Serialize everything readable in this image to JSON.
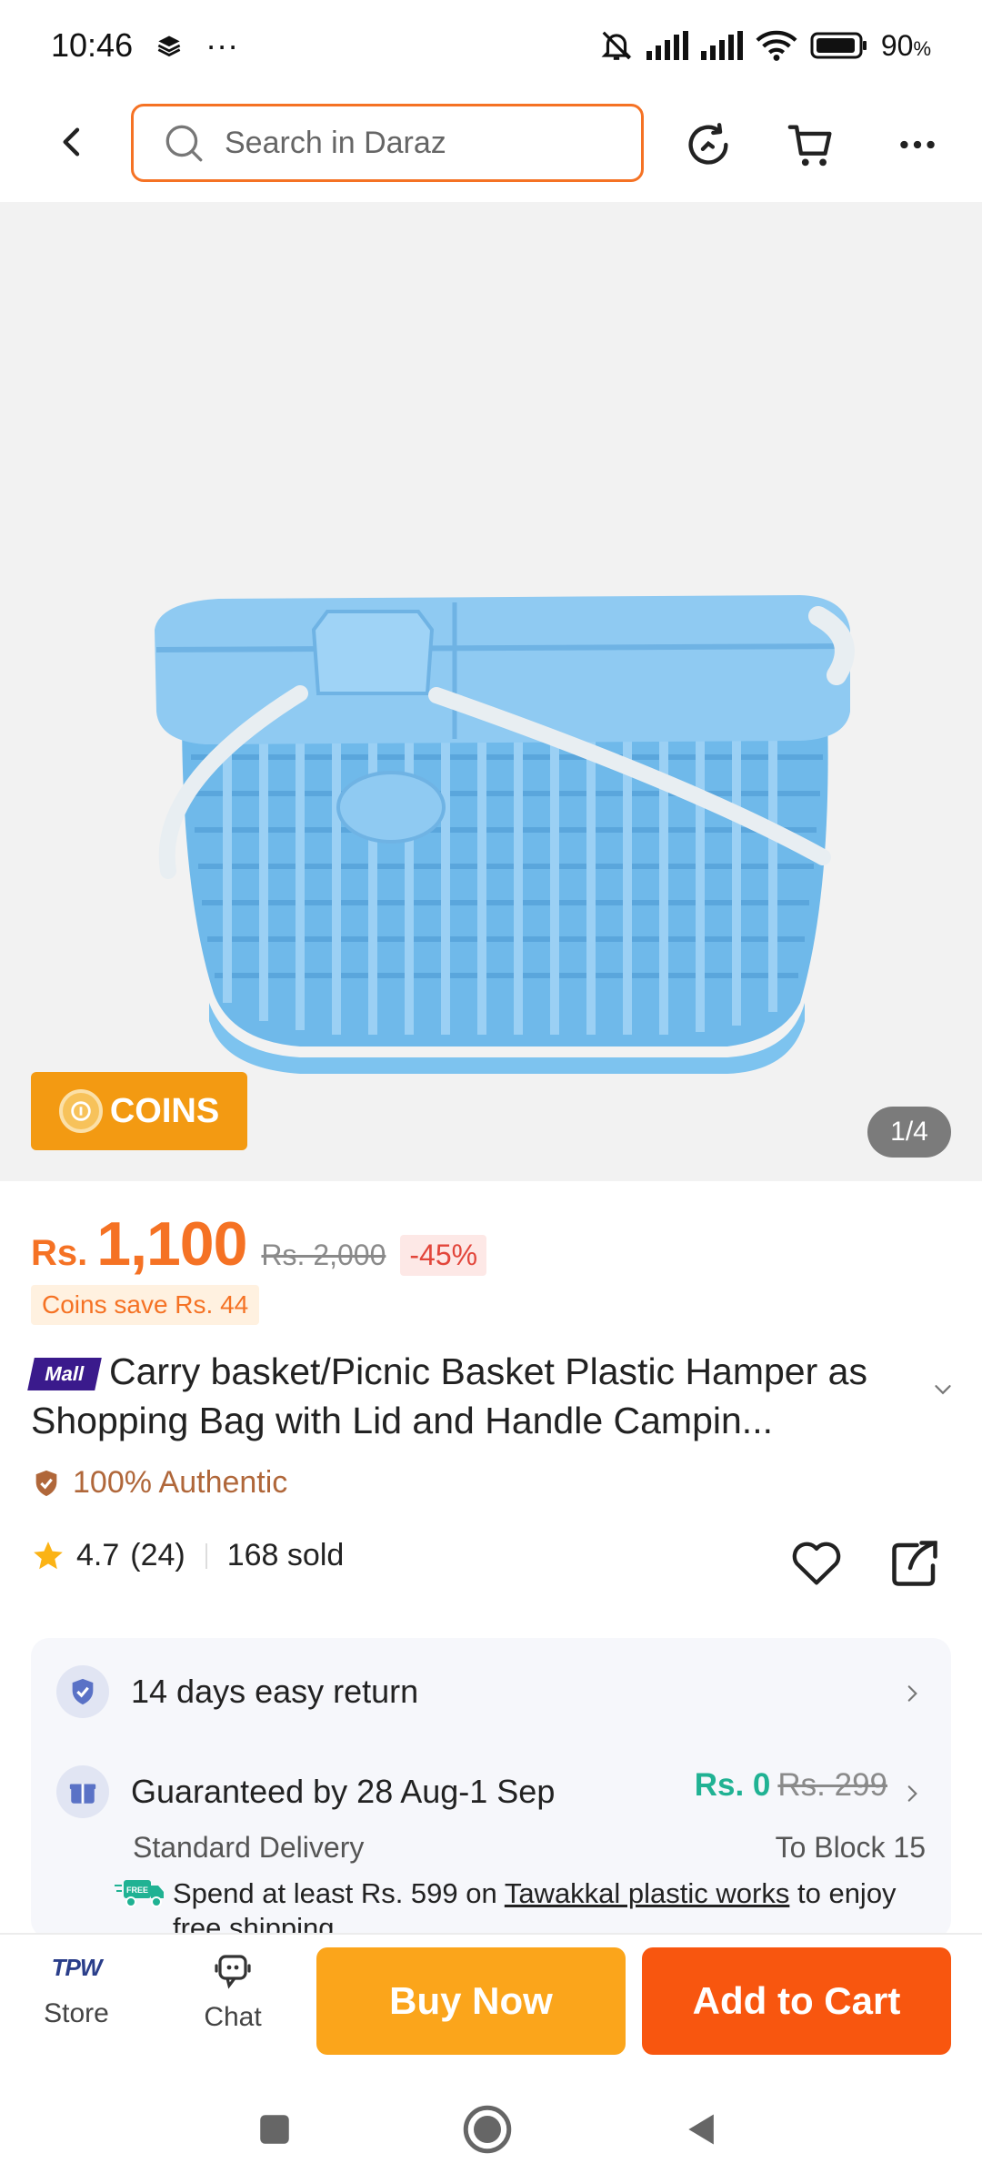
{
  "status_bar": {
    "time": "10:46",
    "dots": "···",
    "battery": "90",
    "battery_unit": "%"
  },
  "search": {
    "placeholder": "Search in Daraz"
  },
  "gallery": {
    "coins_label": "COINS",
    "counter": "1/4"
  },
  "price": {
    "currency": "Rs.",
    "value": "1,100",
    "original": "Rs. 2,000",
    "discount": "-45%",
    "coins_save": "Coins save Rs. 44"
  },
  "product": {
    "mall_label": "Mall",
    "title": "Carry basket/Picnic Basket Plastic Hamper as Shopping Bag with Lid and Handle Campin...",
    "authentic": "100% Authentic",
    "rating": "4.7",
    "reviews": "(24)",
    "sold": "168 sold"
  },
  "services": {
    "return_text": "14 days easy return",
    "guarantee_text": "Guaranteed by 28 Aug-1 Sep",
    "ship_price": "Rs. 0",
    "ship_old": "Rs. 299",
    "delivery_type": "Standard Delivery",
    "destination": "To Block 15",
    "free_badge": "FREE",
    "free_prefix": "Spend at least Rs. 599 on",
    "free_store": "Tawakkal plastic works",
    "free_suffix": "to enjoy free shipping"
  },
  "action_bar": {
    "store_logo": "TPW",
    "store_label": "Store",
    "chat_label": "Chat",
    "buy_now": "Buy Now",
    "add_to_cart": "Add to Cart"
  },
  "colors": {
    "brand_orange": "#f57224",
    "buy_now": "#fba51b",
    "add_to_cart": "#f8560f",
    "coins": "#f39a12",
    "ship_green": "#20b293"
  }
}
